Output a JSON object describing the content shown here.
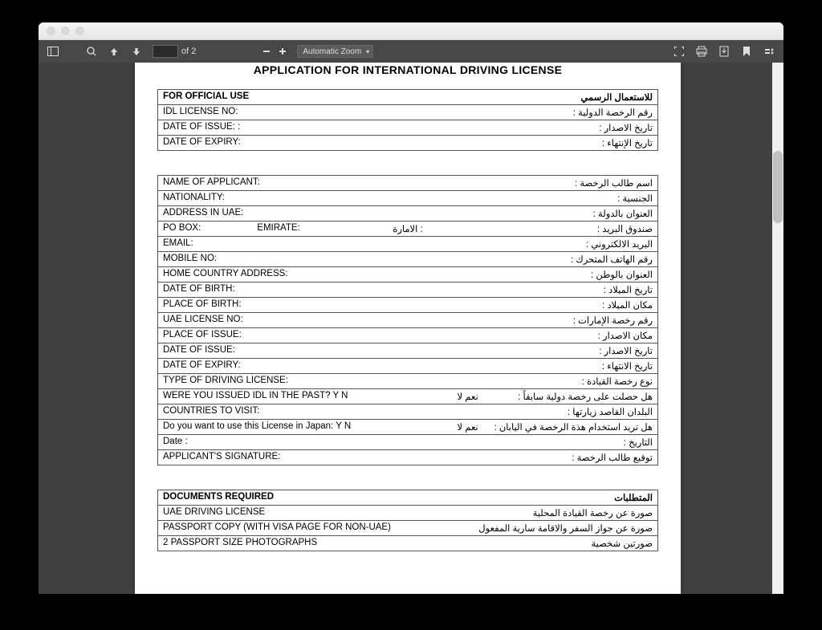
{
  "toolbar": {
    "page_of": "of 2",
    "zoom": "Automatic Zoom"
  },
  "doc": {
    "title": "APPLICATION FOR INTERNATIONAL DRIVING LICENSE"
  },
  "section1": {
    "header_en": "FOR OFFICIAL USE",
    "header_ar": "للاستعمال  الرسمي",
    "rows": [
      {
        "en": "IDL LICENSE NO:",
        "ar": "رقم الرخصة الدولية :"
      },
      {
        "en": "DATE OF ISSUE:   :",
        "ar": "تاريخ الاصدار :"
      },
      {
        "en": "DATE OF EXPIRY:",
        "ar": "تاريخ الإنتهاء :"
      }
    ]
  },
  "section2": {
    "rows": [
      {
        "en": "NAME OF APPLICANT:",
        "ar": "اسم طالب الرخصة :"
      },
      {
        "en": "NATIONALITY:",
        "ar": "الجنسية :"
      },
      {
        "en": "ADDRESS IN UAE:",
        "ar": "العنوان بالدولة :"
      },
      {
        "en": "PO BOX:",
        "mid_en": "EMIRATE:",
        "mid_ar": "الامارة :",
        "ar": "صندوق البريد :"
      },
      {
        "en": "EMAIL:",
        "ar": "البريد الالكتروني :"
      },
      {
        "en": "MOBILE NO:",
        "ar": "رقم الهاتف المتحرك :"
      },
      {
        "en": "HOME COUNTRY ADDRESS:",
        "ar": "العنوان بالوطن :"
      },
      {
        "en": "DATE OF BIRTH:",
        "ar": "تاريخ الميلاد :"
      },
      {
        "en": "PLACE OF BIRTH:",
        "ar": "مكان الميلاد :"
      },
      {
        "en": "UAE LICENSE NO:",
        "ar": "رقم رخصة الإمارات :"
      },
      {
        "en": "PLACE OF ISSUE:",
        "ar": "مكان الاصدار :"
      },
      {
        "en": "DATE OF ISSUE:",
        "ar": "تاريخ الاصدار :"
      },
      {
        "en": "DATE OF EXPIRY:",
        "ar": "تاريخ الانتهاء :"
      },
      {
        "en": "TYPE OF DRIVING LICENSE:",
        "ar": "نوع رخصة القيادة :"
      },
      {
        "en": "WERE YOU ISSUED IDL IN THE PAST?    Y        N",
        "mid_ar2": "نعم        لا",
        "ar": "هل حصلت على رخصة دولية سابقاً :"
      },
      {
        "en": "COUNTRIES TO VISIT:",
        "ar": "البلدان القاصد زيارتها :"
      },
      {
        "en": " Do you want to use this License in  Japan:    Y     N",
        "mid_ar2": "نعم        لا",
        "ar": "هل تريد استخدام هذة الرخصة في اليابان  :"
      },
      {
        "en": "Date :",
        "ar": "التاريخ :"
      },
      {
        "en": "APPLICANT'S SIGNATURE:",
        "ar": "توقيع طالب الرخصة :"
      }
    ]
  },
  "section3": {
    "header_en": "DOCUMENTS REQUIRED",
    "header_ar": "المتطلبات",
    "rows": [
      {
        "en": "UAE DRIVING LICENSE",
        "ar": "صورة عن رخصة القيادة المحلية"
      },
      {
        "en": "PASSPORT COPY (WITH VISA PAGE FOR NON-UAE)",
        "ar": "صورة عن جواز السفر والاقامة سارية المفعول"
      },
      {
        "en": "2 PASSPORT SIZE PHOTOGRAPHS",
        "ar": "صورتين شخصية"
      }
    ]
  }
}
